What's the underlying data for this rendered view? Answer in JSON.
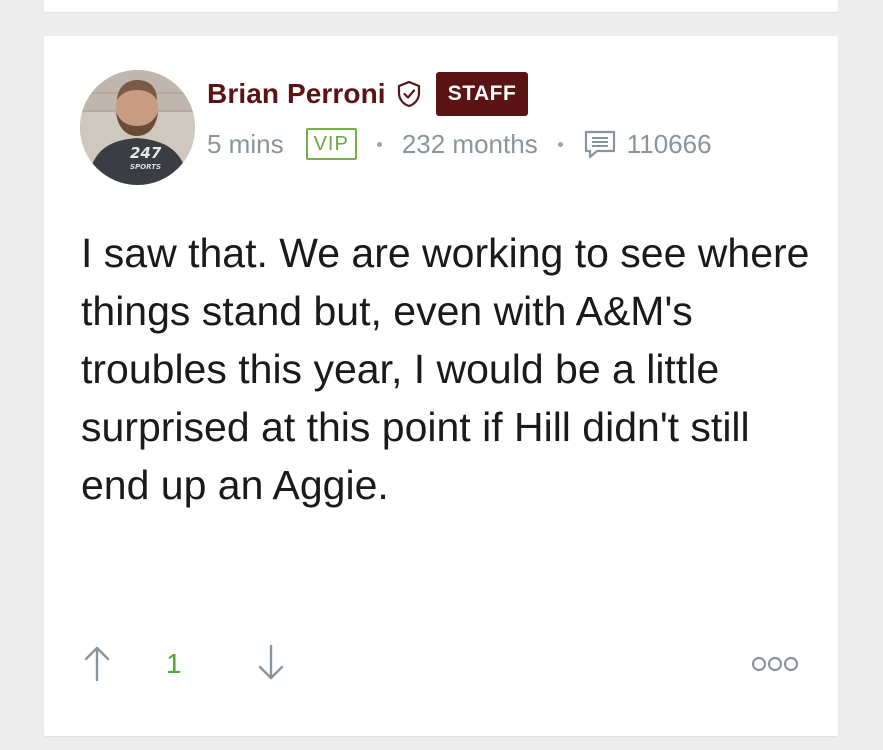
{
  "post": {
    "author": "Brian Perroni",
    "staff_badge": "STAFF",
    "time_ago": "5 mins",
    "vip_badge": "VIP",
    "member_duration": "232 months",
    "post_count": "110666",
    "body": "I saw that. We are working to see where things stand but, even with A&M's troubles this year, I would be a little surprised at this point if Hill didn't still end up an Aggie.",
    "vote_count": "1",
    "avatar_text": "247",
    "avatar_subtext": "SPORTS"
  },
  "icons": {
    "verified": "shield-check-icon",
    "comments": "comment-icon",
    "upvote": "arrow-up-icon",
    "downvote": "arrow-down-icon",
    "more": "more-options-icon"
  },
  "colors": {
    "brand_maroon": "#5b1414",
    "vip_green": "#76b045",
    "vote_green": "#5aa335",
    "meta_gray": "#8795a0",
    "background": "#ededed"
  }
}
